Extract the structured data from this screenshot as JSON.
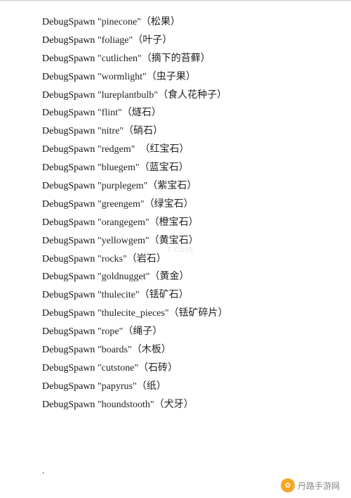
{
  "divider": true,
  "entries": [
    {
      "command": "DebugSpawn",
      "name": "\"pinecone\"",
      "translation": "（松果）"
    },
    {
      "command": "DebugSpawn",
      "name": "\"foliage\"",
      "translation": "（叶子）"
    },
    {
      "command": "DebugSpawn",
      "name": "\"cutlichen\"",
      "translation": "（摘下的苔藓）"
    },
    {
      "command": "DebugSpawn",
      "name": "\"wormlight\"",
      "translation": "（虫子果）"
    },
    {
      "command": "DebugSpawn",
      "name": "\"lureplantbulb\"",
      "translation": "（食人花种子）"
    },
    {
      "command": "DebugSpawn",
      "name": "\"flint\"",
      "translation": "（燧石）"
    },
    {
      "command": "DebugSpawn",
      "name": "\"nitre\"",
      "translation": "（硝石）"
    },
    {
      "command": "DebugSpawn",
      "name": "\"redgem\"",
      "translation": "　（红宝石）"
    },
    {
      "command": "DebugSpawn",
      "name": "\"bluegem\"",
      "translation": "（蓝宝石）"
    },
    {
      "command": "DebugSpawn",
      "name": "\"purplegem\"",
      "translation": "（紫宝石）"
    },
    {
      "command": "DebugSpawn",
      "name": "\"greengem\"",
      "translation": "（绿宝石）"
    },
    {
      "command": "DebugSpawn",
      "name": "\"orangegem\"",
      "translation": "（橙宝石）"
    },
    {
      "command": "DebugSpawn",
      "name": "\"yellowgem\"",
      "translation": "（黄宝石）"
    },
    {
      "command": "DebugSpawn",
      "name": "\"rocks\"",
      "translation": "（岩石）"
    },
    {
      "command": "DebugSpawn",
      "name": "\"goldnugget\"",
      "translation": "（黄金）"
    },
    {
      "command": "DebugSpawn",
      "name": "\"thulecite\"",
      "translation": "（铥矿石）"
    },
    {
      "command": "DebugSpawn",
      "name": "\"thulecite_pieces\"",
      "translation": "（铥矿碎片）"
    },
    {
      "command": "DebugSpawn",
      "name": "\"rope\"",
      "translation": "（绳子）"
    },
    {
      "command": "DebugSpawn",
      "name": "\"boards\"",
      "translation": "（木板）"
    },
    {
      "command": "DebugSpawn",
      "name": "\"cutstone\"",
      "translation": "（石砖）"
    },
    {
      "command": "DebugSpawn",
      "name": "\"papyrus\"",
      "translation": "（纸）"
    },
    {
      "command": "DebugSpawn",
      "name": "\"houndstooth\"",
      "translation": "（犬牙）"
    }
  ],
  "dot": ".",
  "watermark": "t.com",
  "footer": {
    "icon_text": "★",
    "site_text": "丹路手游网"
  }
}
